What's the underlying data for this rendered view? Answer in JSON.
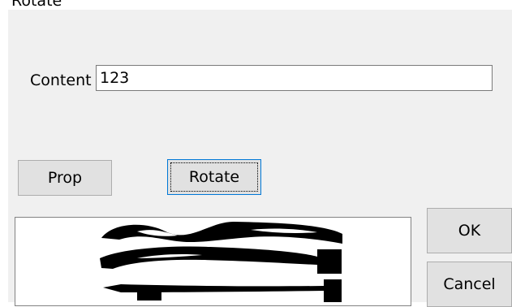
{
  "window": {
    "title": "Rotate"
  },
  "form": {
    "content_label": "Content",
    "content_value": "123"
  },
  "buttons": {
    "prop": "Prop",
    "rotate": "Rotate",
    "ok": "OK",
    "cancel": "Cancel"
  },
  "preview": {
    "rendered_text": "123",
    "ink_color": "#000000",
    "background_color": "#ffffff"
  },
  "colors": {
    "dialog_background": "#f0f0f0",
    "button_face": "#e1e1e1",
    "button_border": "#adadad",
    "focus_border": "#0078d7"
  }
}
